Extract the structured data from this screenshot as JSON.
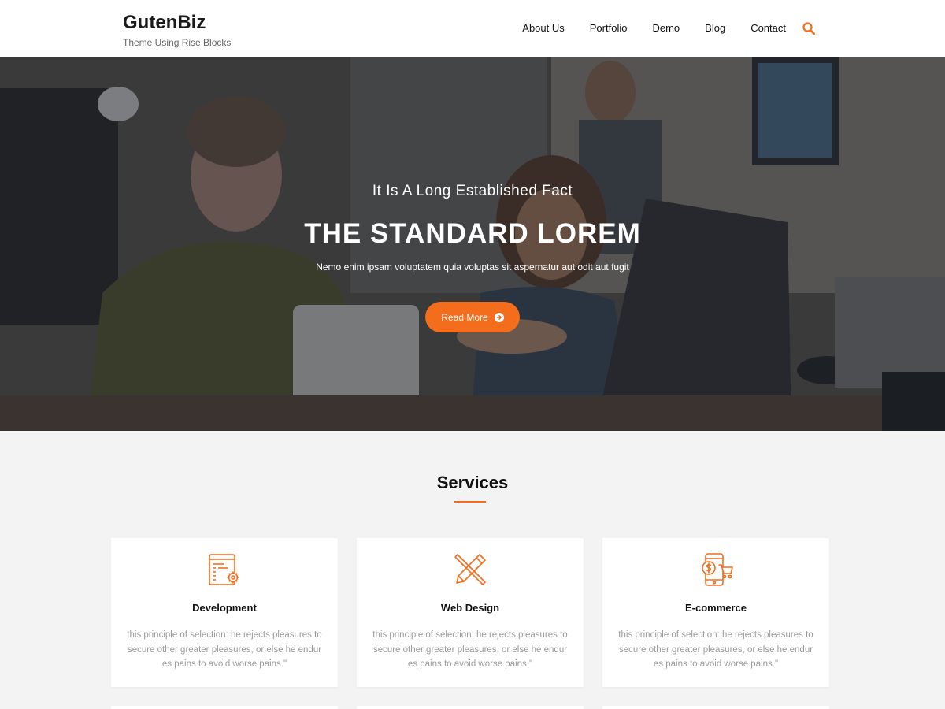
{
  "header": {
    "site_title": "GutenBiz",
    "tagline": "Theme Using Rise Blocks",
    "nav": [
      {
        "label": "About Us"
      },
      {
        "label": "Portfolio"
      },
      {
        "label": "Demo"
      },
      {
        "label": "Blog"
      },
      {
        "label": "Contact"
      }
    ],
    "search_icon": "search-icon"
  },
  "hero": {
    "kicker": "It Is A Long Established Fact",
    "title": "THE STANDARD LOREM",
    "subtitle": "Nemo enim ipsam voluptatem quia voluptas sit aspernatur aut odit aut fugit",
    "button_label": "Read More",
    "button_icon": "arrow-right-circle-icon"
  },
  "services": {
    "heading": "Services",
    "cards": [
      {
        "icon": "development-icon",
        "title": "Development",
        "text": "this principle of selection: he rejects pleasures to secure other greater pleasures, or else he endures pains to avoid worse pains.\""
      },
      {
        "icon": "web-design-icon",
        "title": "Web Design",
        "text": "this principle of selection: he rejects pleasures to secure other greater pleasures, or else he endures pains to avoid worse pains.\""
      },
      {
        "icon": "ecommerce-icon",
        "title": "E-commerce",
        "text": "this principle of selection: he rejects pleasures to secure other greater pleasures, or else he endures pains to avoid worse pains.\""
      }
    ]
  },
  "colors": {
    "accent": "#f36d1d",
    "header_bg": "#ffffff",
    "section_bg": "#f3f3f3"
  }
}
